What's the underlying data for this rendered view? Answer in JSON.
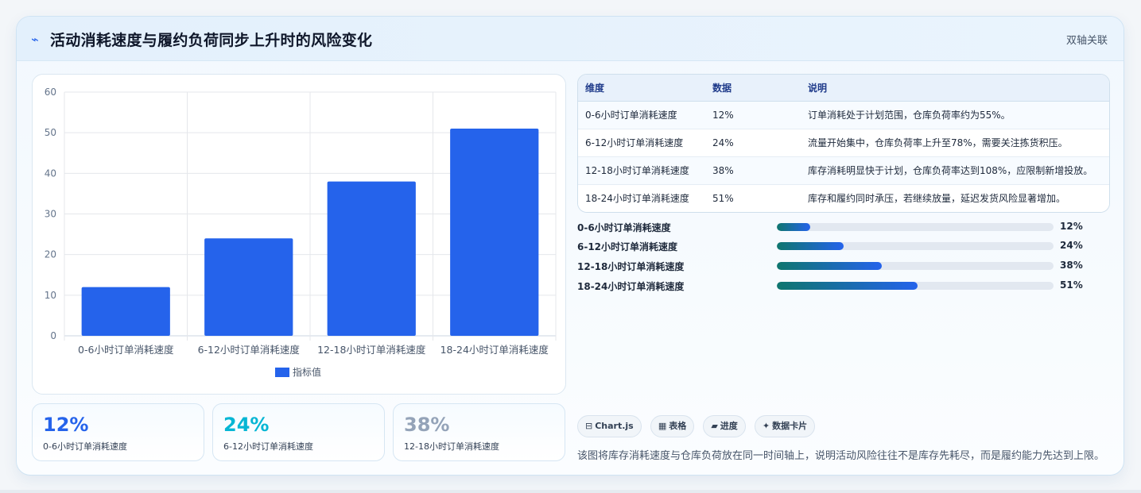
{
  "header": {
    "icon": "pulse-icon",
    "title": "活动消耗速度与履约负荷同步上升时的风险变化",
    "tag": "双轴关联"
  },
  "chart_data": {
    "type": "bar",
    "categories": [
      "0-6小时订单消耗速度",
      "6-12小时订单消耗速度",
      "12-18小时订单消耗速度",
      "18-24小时订单消耗速度"
    ],
    "series": [
      {
        "name": "指标值",
        "values": [
          12,
          24,
          38,
          51
        ]
      }
    ],
    "y_ticks": [
      "0",
      "10",
      "20",
      "30",
      "40",
      "50",
      "60"
    ],
    "ylim": [
      0,
      60
    ],
    "grid": true,
    "legend": "bottom-center",
    "color": "#2563eb"
  },
  "kpis": [
    {
      "value": "12%",
      "label": "0-6小时订单消耗速度",
      "color": "#2563eb"
    },
    {
      "value": "24%",
      "label": "6-12小时订单消耗速度",
      "color": "#06b6d4"
    },
    {
      "value": "38%",
      "label": "12-18小时订单消耗速度",
      "color": "#94a3b8"
    }
  ],
  "table": {
    "headers": [
      "维度",
      "数据",
      "说明"
    ],
    "rows": [
      [
        "0-6小时订单消耗速度",
        "12%",
        "订单消耗处于计划范围，仓库负荷率约为55%。"
      ],
      [
        "6-12小时订单消耗速度",
        "24%",
        "流量开始集中，仓库负荷率上升至78%，需要关注拣货积压。"
      ],
      [
        "12-18小时订单消耗速度",
        "38%",
        "库存消耗明显快于计划，仓库负荷率达到108%，应限制新增投放。"
      ],
      [
        "18-24小时订单消耗速度",
        "51%",
        "库存和履约同时承压，若继续放量，延迟发货风险显著增加。"
      ]
    ]
  },
  "progress": [
    {
      "label": "0-6小时订单消耗速度",
      "value": "12%",
      "fraction": 0.12
    },
    {
      "label": "6-12小时订单消耗速度",
      "value": "24%",
      "fraction": 0.24
    },
    {
      "label": "12-18小时订单消耗速度",
      "value": "38%",
      "fraction": 0.38
    },
    {
      "label": "18-24小时订单消耗速度",
      "value": "51%",
      "fraction": 0.51
    }
  ],
  "chips": [
    {
      "icon": "⊟",
      "label": "Chart.js"
    },
    {
      "icon": "▦",
      "label": "表格"
    },
    {
      "icon": "▰",
      "label": "进度"
    },
    {
      "icon": "✦",
      "label": "数据卡片"
    }
  ],
  "footnote": "该图将库存消耗速度与仓库负荷放在同一时间轴上，说明活动风险往往不是库存先耗尽，而是履约能力先达到上限。"
}
